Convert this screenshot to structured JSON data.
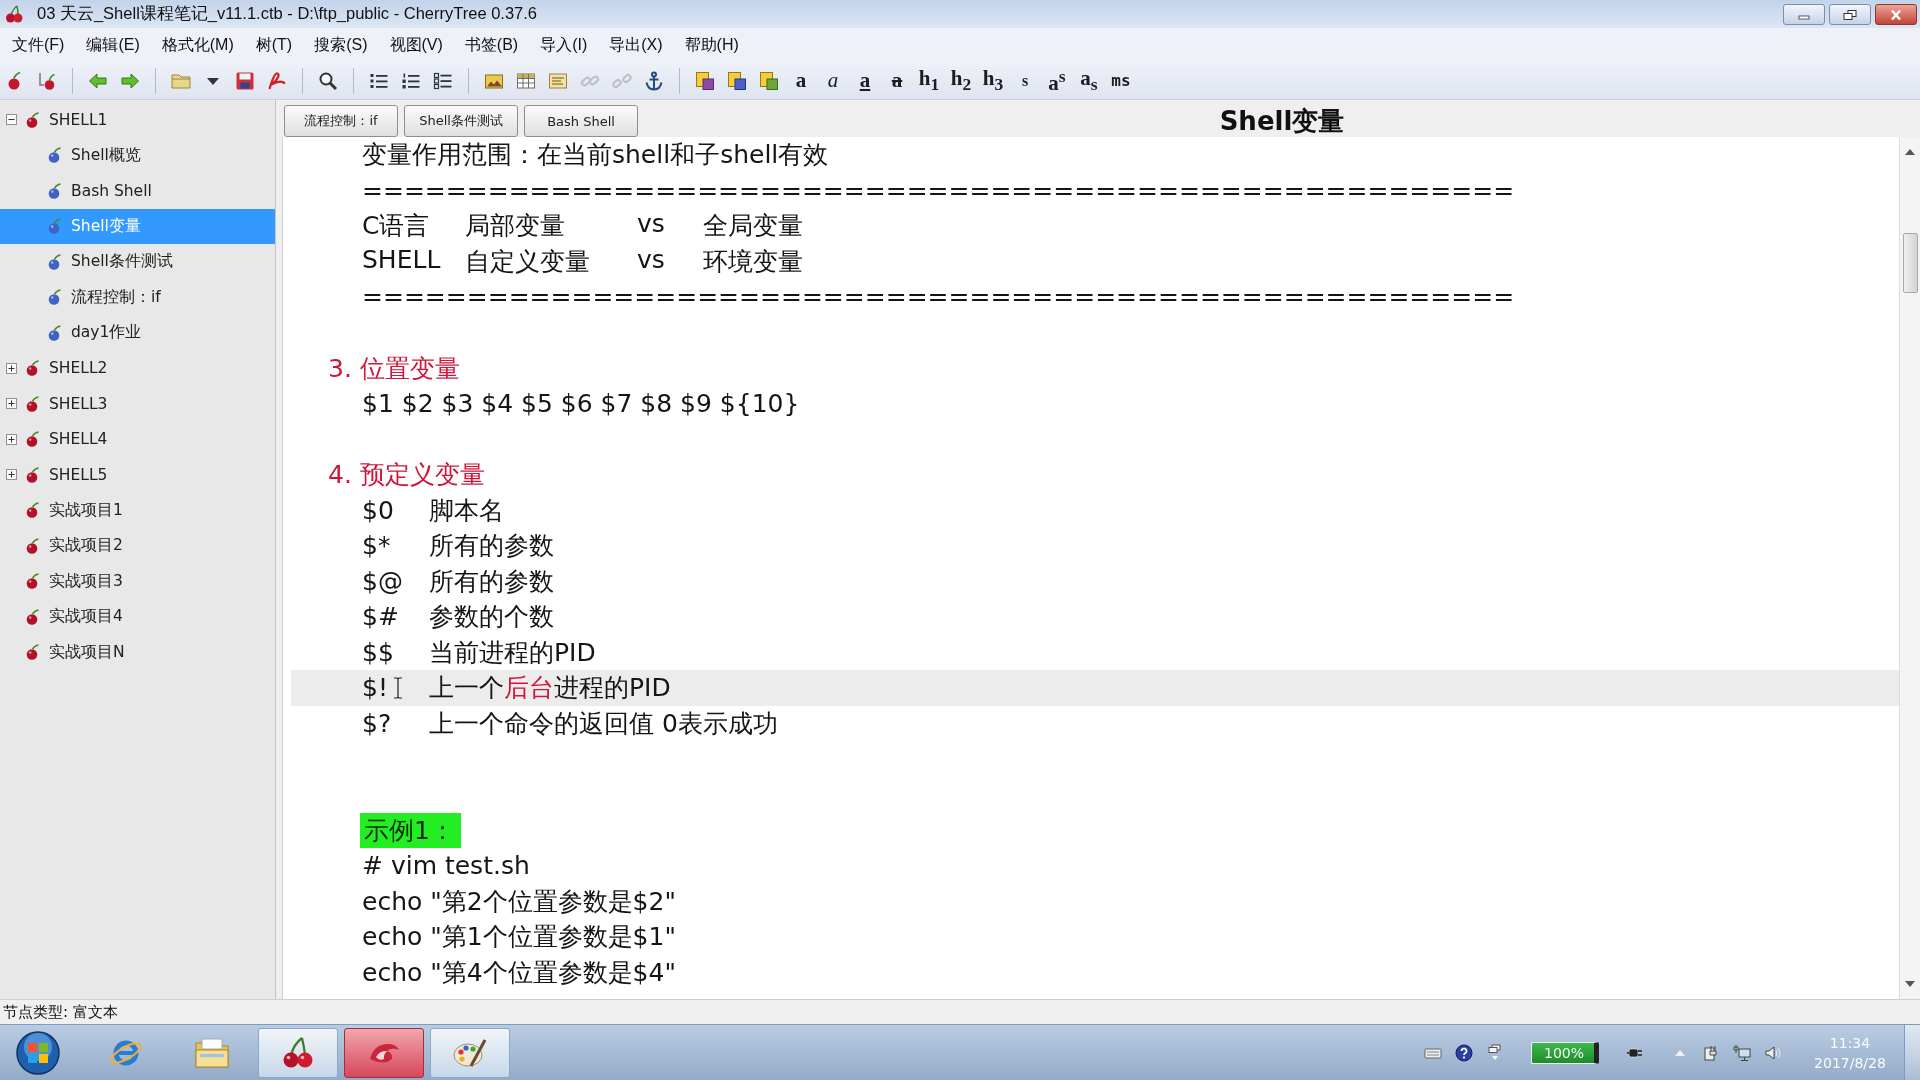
{
  "window": {
    "title": "03 天云_Shell课程笔记_v11.1.ctb - D:\\ftp_public - CherryTree 0.37.6"
  },
  "menu": [
    "文件(F)",
    "编辑(E)",
    "格式化(M)",
    "树(T)",
    "搜索(S)",
    "视图(V)",
    "书签(B)",
    "导入(I)",
    "导出(X)",
    "帮助(H)"
  ],
  "toolbar": {
    "groups": [
      [
        {
          "kind": "add-node",
          "disabled": false
        },
        {
          "kind": "add-child",
          "disabled": false
        }
      ],
      [
        {
          "kind": "back",
          "disabled": false
        },
        {
          "kind": "forward",
          "disabled": false
        }
      ],
      [
        {
          "kind": "open",
          "disabled": false
        },
        {
          "kind": "open-menu",
          "disabled": false
        },
        {
          "kind": "save",
          "disabled": false
        },
        {
          "kind": "export",
          "disabled": false
        }
      ],
      [
        {
          "kind": "find",
          "disabled": false
        }
      ],
      [
        {
          "kind": "bullets",
          "disabled": false
        },
        {
          "kind": "numbers",
          "disabled": false
        },
        {
          "kind": "todo",
          "disabled": false
        }
      ],
      [
        {
          "kind": "image",
          "disabled": false
        },
        {
          "kind": "table",
          "disabled": false
        },
        {
          "kind": "codebox",
          "disabled": false
        },
        {
          "kind": "link",
          "disabled": true
        },
        {
          "kind": "unlink",
          "disabled": true
        },
        {
          "kind": "anchor",
          "disabled": false
        }
      ],
      [
        {
          "kind": "fg-color",
          "disabled": false
        },
        {
          "kind": "bg-color",
          "disabled": false
        },
        {
          "kind": "clear",
          "disabled": false
        },
        {
          "kind": "bold",
          "label": "a",
          "disabled": false
        },
        {
          "kind": "italic",
          "label": "a",
          "disabled": false
        },
        {
          "kind": "underline",
          "label": "a",
          "disabled": false
        },
        {
          "kind": "strike",
          "label": "a",
          "disabled": false
        },
        {
          "kind": "h1",
          "label": "h$_{1}$",
          "disabled": false
        },
        {
          "kind": "h2",
          "label": "h$_{2}$",
          "disabled": false
        },
        {
          "kind": "h3",
          "label": "h$_{3}$",
          "disabled": false
        },
        {
          "kind": "small",
          "label": "s",
          "disabled": false
        },
        {
          "kind": "sup",
          "label": "a$^{s}$",
          "disabled": false
        },
        {
          "kind": "sub",
          "label": "a$_{s}$",
          "disabled": false
        },
        {
          "kind": "mono",
          "label": "ms",
          "disabled": false
        }
      ]
    ]
  },
  "tree": [
    {
      "label": "SHELL1",
      "expanded": true,
      "selected": false,
      "children": [
        {
          "label": "Shell概览",
          "selected": false
        },
        {
          "label": "Bash Shell",
          "selected": false
        },
        {
          "label": "Shell变量",
          "selected": true
        },
        {
          "label": "Shell条件测试",
          "selected": false
        },
        {
          "label": "流程控制：if",
          "selected": false
        },
        {
          "label": "day1作业",
          "selected": false
        }
      ]
    },
    {
      "label": "SHELL2",
      "expanded": false,
      "selected": false
    },
    {
      "label": "SHELL3",
      "expanded": false,
      "selected": false
    },
    {
      "label": "SHELL4",
      "expanded": false,
      "selected": false
    },
    {
      "label": "SHELL5",
      "expanded": false,
      "selected": false
    },
    {
      "label": "实战项目1",
      "selected": false
    },
    {
      "label": "实战项目2",
      "selected": false
    },
    {
      "label": "实战项目3",
      "selected": false
    },
    {
      "label": "实战项目4",
      "selected": false
    },
    {
      "label": "实战项目N",
      "selected": false
    }
  ],
  "node_tabs": [
    "流程控制：if",
    "Shell条件测试",
    "Bash Shell"
  ],
  "node_title": "Shell变量",
  "editor": {
    "lines": [
      {
        "kind": "text",
        "text": "变量作用范围：在当前shell和子shell有效",
        "current": false
      },
      {
        "kind": "text",
        "text": "=======================================================",
        "current": false
      },
      {
        "kind": "columns",
        "cells": [
          "C语言",
          "局部变量",
          "vs",
          "全局变量"
        ],
        "current": false
      },
      {
        "kind": "columns",
        "cells": [
          "SHELL",
          "自定义变量",
          "vs",
          "环境变量"
        ],
        "current": false
      },
      {
        "kind": "text",
        "text": "=======================================================",
        "current": false
      },
      {
        "kind": "blank",
        "current": false
      },
      {
        "kind": "heading",
        "text": "3. 位置变量",
        "current": false
      },
      {
        "kind": "text",
        "text": "$1 $2 $3 $4 $5 $6 $7 $8 $9 ${10}",
        "current": false
      },
      {
        "kind": "blank",
        "current": false
      },
      {
        "kind": "heading",
        "text": "4. 预定义变量",
        "current": false
      },
      {
        "kind": "definition",
        "term": "$0",
        "segments": [
          {
            "text": "脚本名",
            "emphasis": false
          }
        ],
        "current": false
      },
      {
        "kind": "definition",
        "term": "$*",
        "segments": [
          {
            "text": "所有的参数",
            "emphasis": false
          }
        ],
        "current": false
      },
      {
        "kind": "definition",
        "term": "$@",
        "segments": [
          {
            "text": "所有的参数",
            "emphasis": false
          }
        ],
        "current": false
      },
      {
        "kind": "definition",
        "term": "$#",
        "segments": [
          {
            "text": "参数的个数",
            "emphasis": false
          }
        ],
        "current": false
      },
      {
        "kind": "definition",
        "term": "$$",
        "segments": [
          {
            "text": "当前进程的PID",
            "emphasis": false
          }
        ],
        "current": false
      },
      {
        "kind": "definition",
        "term": "$!",
        "segments": [
          {
            "text": "上一个",
            "emphasis": false
          },
          {
            "text": "后台",
            "emphasis": true
          },
          {
            "text": "进程的PID",
            "emphasis": false
          }
        ],
        "current": true
      },
      {
        "kind": "definition",
        "term": "$?",
        "segments": [
          {
            "text": "上一个命令的返回值 0表示成功",
            "emphasis": false
          }
        ],
        "current": false
      },
      {
        "kind": "blank",
        "current": false
      },
      {
        "kind": "blank",
        "current": false
      },
      {
        "kind": "label",
        "text": "示例1：",
        "current": false
      },
      {
        "kind": "text",
        "text": "# vim test.sh",
        "current": false
      },
      {
        "kind": "text",
        "text": "echo \"第2个位置参数是$2\"",
        "current": false
      },
      {
        "kind": "text",
        "text": "echo \"第1个位置参数是$1\"",
        "current": false
      },
      {
        "kind": "text",
        "text": "echo \"第4个位置参数是$4\"",
        "current": false
      }
    ]
  },
  "status_bar": {
    "text": "节点类型: 富文本"
  },
  "taskbar": {
    "apps": [
      {
        "kind": "browser",
        "running": false,
        "alert": false
      },
      {
        "kind": "files",
        "running": false,
        "alert": false
      },
      {
        "kind": "cherry",
        "running": true,
        "alert": false
      },
      {
        "kind": "swirl",
        "running": true,
        "alert": true
      },
      {
        "kind": "paint",
        "running": true,
        "alert": false
      }
    ],
    "battery": "100%",
    "time": "11:34",
    "date": "2017/8/28"
  }
}
